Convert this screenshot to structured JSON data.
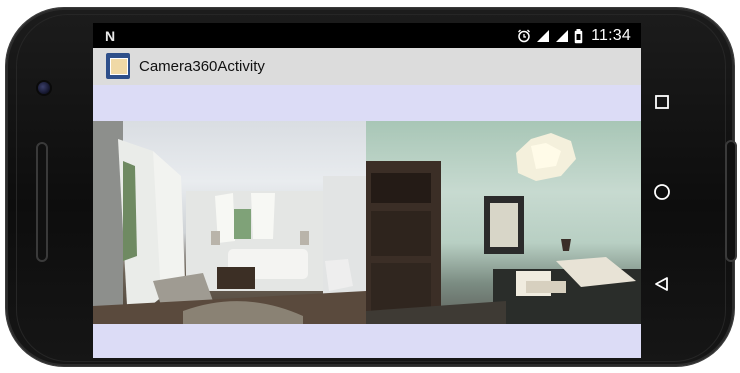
{
  "device": {
    "name": "android-phone-landscape"
  },
  "status_bar": {
    "notification_icon": "N",
    "icons": [
      "alarm-icon",
      "signal-icon",
      "signal-icon",
      "battery-icon"
    ],
    "time": "11:34"
  },
  "action_bar": {
    "app_icon": "app-icon",
    "title": "Camera360Activity"
  },
  "content": {
    "background_color": "#dcdcf6",
    "panorama": {
      "left_view": "living-room",
      "right_view": "study-room"
    }
  },
  "nav_bar": {
    "buttons": [
      "recents-square-icon",
      "home-circle-icon",
      "back-triangle-icon"
    ]
  }
}
